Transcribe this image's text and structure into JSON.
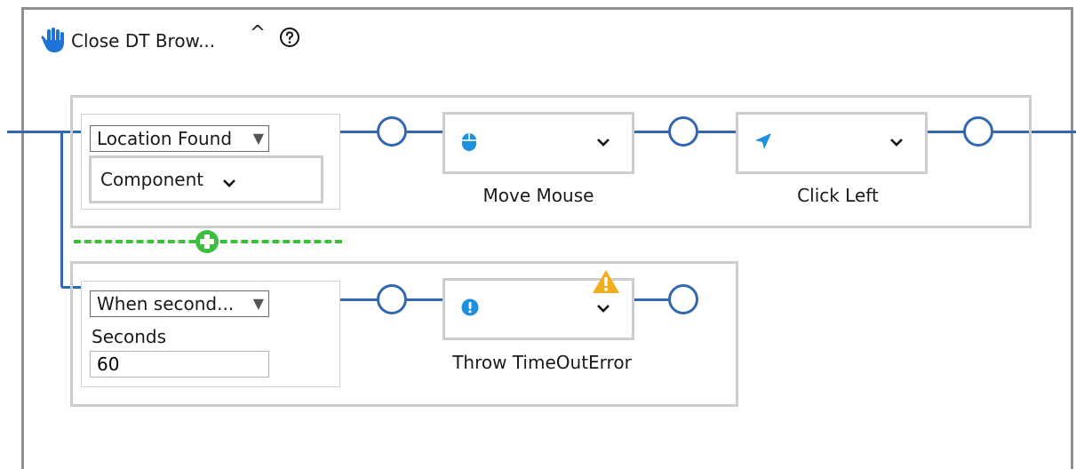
{
  "header": {
    "title": "Close DT Brow...",
    "collapse_glyph": "^",
    "icons": {
      "title": "hand-stop-icon",
      "help": "help-circle-icon"
    }
  },
  "branches": [
    {
      "condition": {
        "select_value": "Location Found",
        "dropdown_label": "Component"
      },
      "actions": [
        {
          "label": "Move Mouse",
          "icon": "mouse-icon"
        },
        {
          "label": "Click Left",
          "icon": "cursor-arrow-icon"
        }
      ]
    },
    {
      "condition": {
        "select_value": "When second...",
        "field_label": "Seconds",
        "field_value": "60"
      },
      "actions": [
        {
          "label": "Throw TimeOutError",
          "icon": "alert-circle-icon",
          "warning": true
        }
      ]
    }
  ],
  "colors": {
    "connector": "#3367b1",
    "border": "#cdcdcd",
    "add": "#3cbf3c",
    "icon": "#1e90e0",
    "warning": "#f0ad1e"
  }
}
